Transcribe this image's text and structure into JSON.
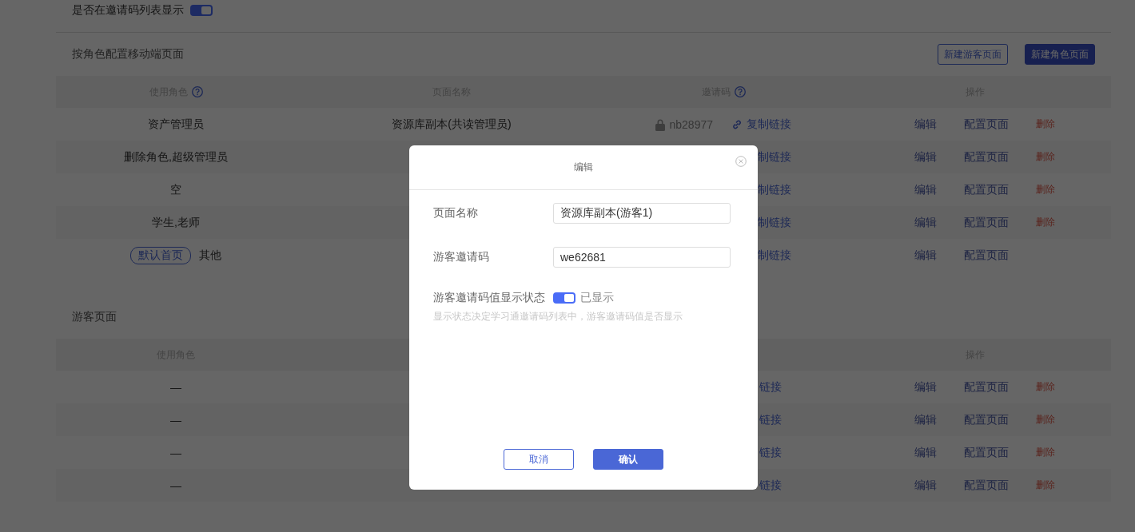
{
  "show_in_list": {
    "label": "是否在邀请码列表显示",
    "on": true
  },
  "role_section": {
    "title": "按角色配置移动端页面",
    "buttons": [
      {
        "label": "新建游客页面",
        "kind": "outline"
      },
      {
        "label": "新建角色页面",
        "kind": "primary"
      }
    ],
    "columns": [
      {
        "label": "使用角色",
        "help": true
      },
      {
        "label": "页面名称",
        "help": false
      },
      {
        "label": "邀请码",
        "help": true
      },
      {
        "label": "操作",
        "help": false
      }
    ],
    "rows": [
      {
        "role": "资产管理员",
        "page_name": "资源库副本(共读管理员)",
        "code": "nb28977",
        "locked": true,
        "link": "复制链接",
        "actions": [
          {
            "label": "编辑",
            "kind": "edit"
          },
          {
            "label": "配置页面",
            "kind": "config"
          },
          {
            "label": "删除",
            "kind": "delete"
          }
        ]
      },
      {
        "role": "删除角色,超级管理员",
        "link": "制链接",
        "actions": [
          {
            "label": "编辑",
            "kind": "edit"
          },
          {
            "label": "配置页面",
            "kind": "config"
          },
          {
            "label": "删除",
            "kind": "delete"
          }
        ]
      },
      {
        "role": "空",
        "link": "制链接",
        "actions": [
          {
            "label": "编辑",
            "kind": "edit"
          },
          {
            "label": "配置页面",
            "kind": "config"
          },
          {
            "label": "删除",
            "kind": "delete"
          }
        ]
      },
      {
        "role": "学生,老师",
        "link": "制链接",
        "actions": [
          {
            "label": "编辑",
            "kind": "edit"
          },
          {
            "label": "配置页面",
            "kind": "config"
          },
          {
            "label": "删除",
            "kind": "delete"
          }
        ]
      },
      {
        "role": "其他",
        "badge": "默认首页",
        "link": "制链接",
        "actions": [
          {
            "label": "编辑",
            "kind": "edit"
          },
          {
            "label": "配置页面",
            "kind": "config"
          }
        ]
      }
    ]
  },
  "guest_section": {
    "title": "游客页面",
    "role_column": "使用角色",
    "actions_column": "操作",
    "rows": [
      {
        "role": "—",
        "link": "链接",
        "actions": [
          {
            "label": "编辑",
            "kind": "edit"
          },
          {
            "label": "配置页面",
            "kind": "config"
          },
          {
            "label": "删除",
            "kind": "delete"
          }
        ]
      },
      {
        "role": "—",
        "link": "链接",
        "actions": [
          {
            "label": "编辑",
            "kind": "edit"
          },
          {
            "label": "配置页面",
            "kind": "config"
          },
          {
            "label": "删除",
            "kind": "delete"
          }
        ]
      },
      {
        "role": "—",
        "link": "链接",
        "actions": [
          {
            "label": "编辑",
            "kind": "edit"
          },
          {
            "label": "配置页面",
            "kind": "config"
          },
          {
            "label": "删除",
            "kind": "delete"
          }
        ]
      },
      {
        "role": "—",
        "link": "链接",
        "actions": [
          {
            "label": "编辑",
            "kind": "edit"
          },
          {
            "label": "配置页面",
            "kind": "config"
          },
          {
            "label": "删除",
            "kind": "delete"
          }
        ]
      }
    ]
  },
  "dialog": {
    "title": "编辑",
    "fields": [
      {
        "label": "页面名称",
        "value": "资源库副本(游客1)"
      },
      {
        "label": "游客邀请码",
        "value": "we62681"
      }
    ],
    "display_toggle": {
      "label": "游客邀请码值显示状态",
      "on": true,
      "state_text": "已显示",
      "hint": "显示状态决定学习通邀请码列表中，游客邀请码值是否显示"
    },
    "buttons": [
      {
        "label": "取消",
        "kind": "outline"
      },
      {
        "label": "确认",
        "kind": "primary"
      }
    ]
  }
}
